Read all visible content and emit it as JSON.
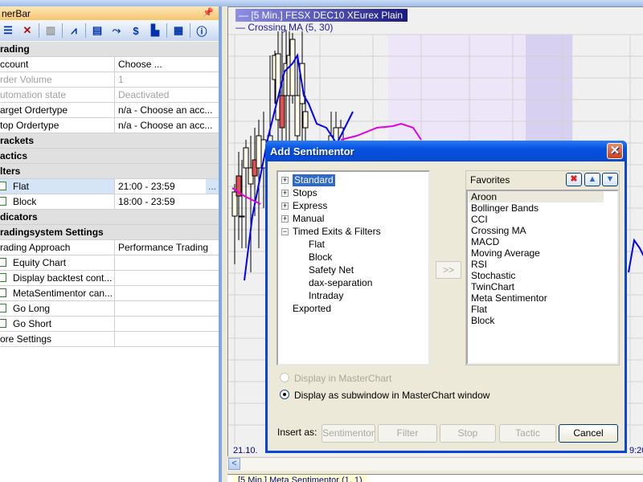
{
  "left_panel": {
    "title": "nerBar",
    "pin_icon": "pin-icon",
    "toolbar": [
      "list-icon",
      "delete-icon",
      "building-icon",
      "chart-line-icon",
      "printer-icon",
      "crossing-icon",
      "dollar-icon",
      "histogram-icon",
      "table-icon",
      "info-table-icon"
    ],
    "rows": [
      {
        "type": "cat",
        "key": "rading"
      },
      {
        "key": "ccount",
        "value": "Choose ..."
      },
      {
        "key": "rder Volume",
        "value": "1",
        "disabled": true
      },
      {
        "key": "utomation state",
        "value": "Deactivated",
        "disabled": true
      },
      {
        "key": "arget Ordertype",
        "value": "n/a - Choose an acc..."
      },
      {
        "key": "top Ordertype",
        "value": "n/a - Choose an acc..."
      },
      {
        "type": "cat",
        "key": "rackets"
      },
      {
        "type": "cat",
        "key": "actics"
      },
      {
        "type": "cat",
        "key": "lters"
      },
      {
        "key": "Flat",
        "value": "21:00 - 23:59",
        "checkbox": true,
        "checked": true,
        "selected": true,
        "ellipsis": "..."
      },
      {
        "key": "Block",
        "value": "18:00 - 23:59",
        "checkbox": true,
        "checked": true
      },
      {
        "type": "cat",
        "key": "dicators"
      },
      {
        "type": "cat",
        "key": "radingsystem Settings"
      },
      {
        "key": "rading Approach",
        "value": "Performance Trading"
      },
      {
        "key": "Equity Chart",
        "value": "",
        "checkbox": true,
        "checked": false
      },
      {
        "key": "Display backtest cont...",
        "value": "",
        "checkbox": true,
        "checked": true
      },
      {
        "key": "MetaSentimentor can...",
        "value": "",
        "checkbox": true,
        "checked": false
      },
      {
        "key": "Go Long",
        "value": "",
        "checkbox": true,
        "checked": true
      },
      {
        "key": "Go Short",
        "value": "",
        "checkbox": true,
        "checked": false
      },
      {
        "key": "ore Settings",
        "value": ""
      }
    ]
  },
  "chart": {
    "legend_main": "— [5 Min.] FESX DEC10    XEurex Plain",
    "legend_indicator": "— Crossing MA  (5, 30)",
    "x_label_first": "21.10.",
    "x_label_last": "9:20",
    "subwindow_title": "[5 Min.] Meta Sentimentor  (1, 1)",
    "colors": {
      "ma": "#0000ff",
      "signal": "#e000e0",
      "bear": "#e05050",
      "bull": "#fffce8",
      "highlight": "#ece6f8"
    }
  },
  "dialog": {
    "title": "Add Sentimentor",
    "tree": [
      {
        "label": "Standard",
        "level": 0,
        "expander": "+",
        "selected": true
      },
      {
        "label": "Stops",
        "level": 0,
        "expander": "+"
      },
      {
        "label": "Express",
        "level": 0,
        "expander": "+"
      },
      {
        "label": "Manual",
        "level": 0,
        "expander": "+"
      },
      {
        "label": "Timed Exits & Filters",
        "level": 0,
        "expander": "−"
      },
      {
        "label": "Flat",
        "level": 1
      },
      {
        "label": "Block",
        "level": 1
      },
      {
        "label": "Safety Net",
        "level": 1
      },
      {
        "label": "dax-separation",
        "level": 1
      },
      {
        "label": "Intraday",
        "level": 1
      },
      {
        "label": "Exported",
        "level": 0
      }
    ],
    "add_button": ">>",
    "favorites_label": "Favorites",
    "favorites": [
      "Aroon",
      "Bollinger Bands",
      "CCI",
      "Crossing MA",
      "MACD",
      "Moving Average",
      "RSI",
      "Stochastic",
      "TwinChart",
      "Meta Sentimentor",
      "Flat",
      "Block"
    ],
    "radio_master": "Display in MasterChart",
    "radio_sub": "Display as subwindow in MasterChart window",
    "insert_as": "Insert as:",
    "buttons": {
      "sentimentor": "Sentimentor",
      "filter": "Filter",
      "stop": "Stop",
      "tactic": "Tactic",
      "cancel": "Cancel"
    }
  }
}
